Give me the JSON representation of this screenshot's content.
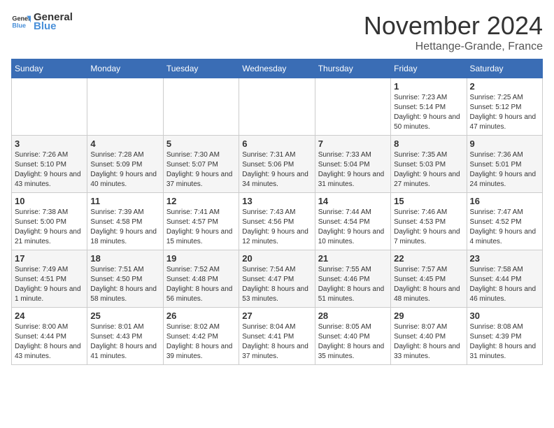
{
  "logo": {
    "text_general": "General",
    "text_blue": "Blue"
  },
  "title": "November 2024",
  "subtitle": "Hettange-Grande, France",
  "days_of_week": [
    "Sunday",
    "Monday",
    "Tuesday",
    "Wednesday",
    "Thursday",
    "Friday",
    "Saturday"
  ],
  "weeks": [
    [
      {
        "day": "",
        "info": ""
      },
      {
        "day": "",
        "info": ""
      },
      {
        "day": "",
        "info": ""
      },
      {
        "day": "",
        "info": ""
      },
      {
        "day": "",
        "info": ""
      },
      {
        "day": "1",
        "info": "Sunrise: 7:23 AM\nSunset: 5:14 PM\nDaylight: 9 hours and 50 minutes."
      },
      {
        "day": "2",
        "info": "Sunrise: 7:25 AM\nSunset: 5:12 PM\nDaylight: 9 hours and 47 minutes."
      }
    ],
    [
      {
        "day": "3",
        "info": "Sunrise: 7:26 AM\nSunset: 5:10 PM\nDaylight: 9 hours and 43 minutes."
      },
      {
        "day": "4",
        "info": "Sunrise: 7:28 AM\nSunset: 5:09 PM\nDaylight: 9 hours and 40 minutes."
      },
      {
        "day": "5",
        "info": "Sunrise: 7:30 AM\nSunset: 5:07 PM\nDaylight: 9 hours and 37 minutes."
      },
      {
        "day": "6",
        "info": "Sunrise: 7:31 AM\nSunset: 5:06 PM\nDaylight: 9 hours and 34 minutes."
      },
      {
        "day": "7",
        "info": "Sunrise: 7:33 AM\nSunset: 5:04 PM\nDaylight: 9 hours and 31 minutes."
      },
      {
        "day": "8",
        "info": "Sunrise: 7:35 AM\nSunset: 5:03 PM\nDaylight: 9 hours and 27 minutes."
      },
      {
        "day": "9",
        "info": "Sunrise: 7:36 AM\nSunset: 5:01 PM\nDaylight: 9 hours and 24 minutes."
      }
    ],
    [
      {
        "day": "10",
        "info": "Sunrise: 7:38 AM\nSunset: 5:00 PM\nDaylight: 9 hours and 21 minutes."
      },
      {
        "day": "11",
        "info": "Sunrise: 7:39 AM\nSunset: 4:58 PM\nDaylight: 9 hours and 18 minutes."
      },
      {
        "day": "12",
        "info": "Sunrise: 7:41 AM\nSunset: 4:57 PM\nDaylight: 9 hours and 15 minutes."
      },
      {
        "day": "13",
        "info": "Sunrise: 7:43 AM\nSunset: 4:56 PM\nDaylight: 9 hours and 12 minutes."
      },
      {
        "day": "14",
        "info": "Sunrise: 7:44 AM\nSunset: 4:54 PM\nDaylight: 9 hours and 10 minutes."
      },
      {
        "day": "15",
        "info": "Sunrise: 7:46 AM\nSunset: 4:53 PM\nDaylight: 9 hours and 7 minutes."
      },
      {
        "day": "16",
        "info": "Sunrise: 7:47 AM\nSunset: 4:52 PM\nDaylight: 9 hours and 4 minutes."
      }
    ],
    [
      {
        "day": "17",
        "info": "Sunrise: 7:49 AM\nSunset: 4:51 PM\nDaylight: 9 hours and 1 minute."
      },
      {
        "day": "18",
        "info": "Sunrise: 7:51 AM\nSunset: 4:50 PM\nDaylight: 8 hours and 58 minutes."
      },
      {
        "day": "19",
        "info": "Sunrise: 7:52 AM\nSunset: 4:48 PM\nDaylight: 8 hours and 56 minutes."
      },
      {
        "day": "20",
        "info": "Sunrise: 7:54 AM\nSunset: 4:47 PM\nDaylight: 8 hours and 53 minutes."
      },
      {
        "day": "21",
        "info": "Sunrise: 7:55 AM\nSunset: 4:46 PM\nDaylight: 8 hours and 51 minutes."
      },
      {
        "day": "22",
        "info": "Sunrise: 7:57 AM\nSunset: 4:45 PM\nDaylight: 8 hours and 48 minutes."
      },
      {
        "day": "23",
        "info": "Sunrise: 7:58 AM\nSunset: 4:44 PM\nDaylight: 8 hours and 46 minutes."
      }
    ],
    [
      {
        "day": "24",
        "info": "Sunrise: 8:00 AM\nSunset: 4:44 PM\nDaylight: 8 hours and 43 minutes."
      },
      {
        "day": "25",
        "info": "Sunrise: 8:01 AM\nSunset: 4:43 PM\nDaylight: 8 hours and 41 minutes."
      },
      {
        "day": "26",
        "info": "Sunrise: 8:02 AM\nSunset: 4:42 PM\nDaylight: 8 hours and 39 minutes."
      },
      {
        "day": "27",
        "info": "Sunrise: 8:04 AM\nSunset: 4:41 PM\nDaylight: 8 hours and 37 minutes."
      },
      {
        "day": "28",
        "info": "Sunrise: 8:05 AM\nSunset: 4:40 PM\nDaylight: 8 hours and 35 minutes."
      },
      {
        "day": "29",
        "info": "Sunrise: 8:07 AM\nSunset: 4:40 PM\nDaylight: 8 hours and 33 minutes."
      },
      {
        "day": "30",
        "info": "Sunrise: 8:08 AM\nSunset: 4:39 PM\nDaylight: 8 hours and 31 minutes."
      }
    ]
  ]
}
